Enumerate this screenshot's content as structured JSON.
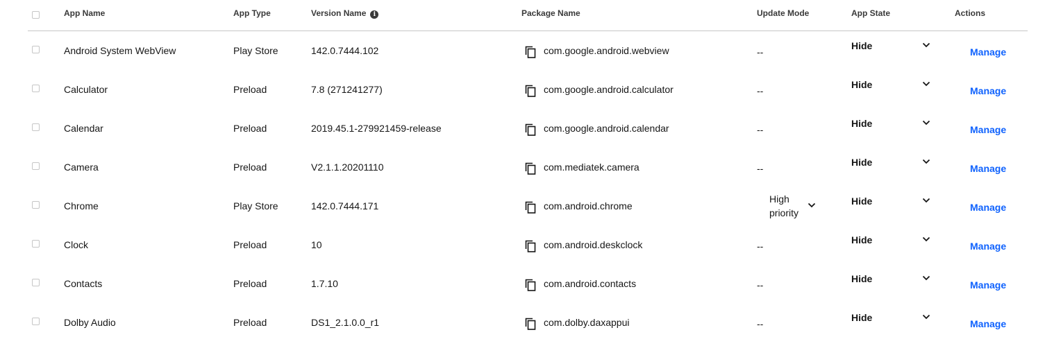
{
  "header": {
    "app_name": "App Name",
    "app_type": "App Type",
    "version_name": "Version Name",
    "package_name": "Package Name",
    "update_mode": "Update Mode",
    "app_state": "App State",
    "actions": "Actions"
  },
  "icons": {
    "info": "info-icon",
    "copy": "copy-icon",
    "chevron": "chevron-down-icon"
  },
  "colors": {
    "link": "#0f62fe",
    "text": "#161616",
    "divider": "#c6c6c6"
  },
  "rows": [
    {
      "name": "Android System WebView",
      "type": "Play Store",
      "version": "142.0.7444.102",
      "package": "com.google.android.webview",
      "update_mode": "--",
      "update_select": null,
      "state": "Hide",
      "action": "Manage"
    },
    {
      "name": "Calculator",
      "type": "Preload",
      "version": "7.8 (271241277)",
      "package": "com.google.android.calculator",
      "update_mode": "--",
      "update_select": null,
      "state": "Hide",
      "action": "Manage"
    },
    {
      "name": "Calendar",
      "type": "Preload",
      "version": "2019.45.1-279921459-release",
      "package": "com.google.android.calendar",
      "update_mode": "--",
      "update_select": null,
      "state": "Hide",
      "action": "Manage"
    },
    {
      "name": "Camera",
      "type": "Preload",
      "version": "V2.1.1.20201110",
      "package": "com.mediatek.camera",
      "update_mode": "--",
      "update_select": null,
      "state": "Hide",
      "action": "Manage"
    },
    {
      "name": "Chrome",
      "type": "Play Store",
      "version": "142.0.7444.171",
      "package": "com.android.chrome",
      "update_mode": null,
      "update_select": [
        "High",
        "priority"
      ],
      "state": "Hide",
      "action": "Manage"
    },
    {
      "name": "Clock",
      "type": "Preload",
      "version": "10",
      "package": "com.android.deskclock",
      "update_mode": "--",
      "update_select": null,
      "state": "Hide",
      "action": "Manage"
    },
    {
      "name": "Contacts",
      "type": "Preload",
      "version": "1.7.10",
      "package": "com.android.contacts",
      "update_mode": "--",
      "update_select": null,
      "state": "Hide",
      "action": "Manage"
    },
    {
      "name": "Dolby Audio",
      "type": "Preload",
      "version": "DS1_2.1.0.0_r1",
      "package": "com.dolby.daxappui",
      "update_mode": "--",
      "update_select": null,
      "state": "Hide",
      "action": "Manage"
    }
  ]
}
